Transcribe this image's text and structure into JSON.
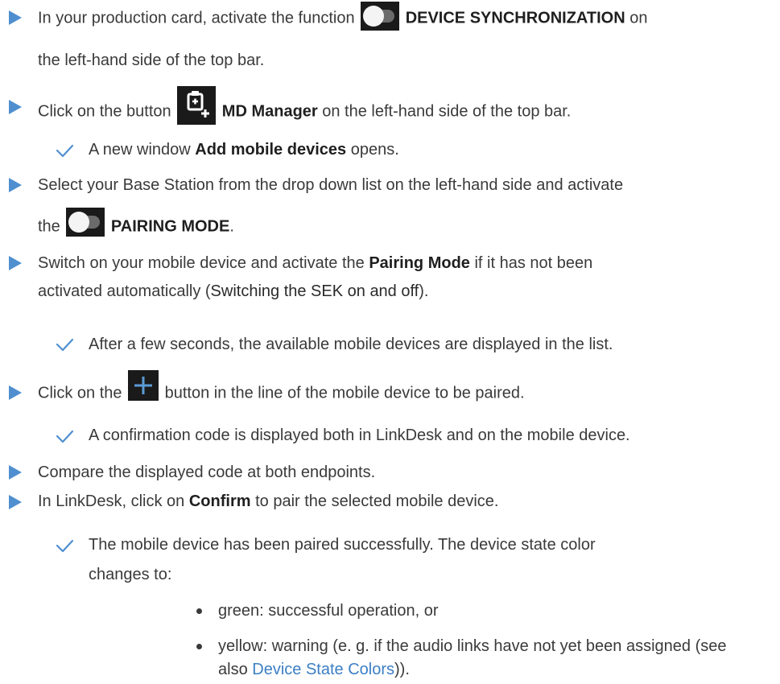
{
  "steps": [
    {
      "before": "In your production card, activate the function ",
      "icon": "toggle-switch-icon",
      "bold": "DEVICE SYNCHRONIZATION",
      "after": " on",
      "line2": "the left-hand side of the top bar."
    },
    {
      "before": "Click on the button ",
      "icon": "md-manager-icon",
      "bold": "MD Manager",
      "after": " on the left-hand side of the top bar.",
      "result": {
        "before": "A new window ",
        "bold": "Add mobile devices",
        "after": " opens."
      }
    },
    {
      "line1": "Select your Base Station from the drop down list on the left-hand side and activate",
      "before": "the ",
      "icon": "toggle-switch-icon",
      "bold": "PAIRING MODE",
      "after": "."
    },
    {
      "before": "Switch on your mobile device and activate the ",
      "bold": "Pairing Mode",
      "after": " if it has not been",
      "line2_before": "activated automatically (",
      "line2_bold": "Switching the SEK on and off",
      "line2_after": ").",
      "result": "After a few seconds, the available mobile devices are displayed in the list."
    },
    {
      "before": "Click on the ",
      "icon": "plus-icon",
      "after": " button in the line of the mobile device to be paired.",
      "result": "A confirmation code is displayed both in LinkDesk and on the mobile device."
    },
    {
      "text": "Compare the displayed code at both endpoints."
    },
    {
      "before": "In LinkDesk, click on ",
      "bold": "Confirm",
      "after": " to pair the selected mobile device.",
      "result_line1": "The mobile device has been paired successfully. The device state color",
      "result_line2": "changes to:",
      "bullets": [
        "green: successful operation, or",
        "yellow: warning (e. g. if the audio links have not yet been assigned (see"
      ],
      "bullet2_line2_before": "also ",
      "bullet2_link": "Device State Colors",
      "bullet2_line2_after": "))."
    }
  ],
  "colors": {
    "arrow": "#4f8fd0",
    "check": "#4f8fd0",
    "link": "#3b7fc4",
    "icon_bg": "#1a1a1a"
  }
}
